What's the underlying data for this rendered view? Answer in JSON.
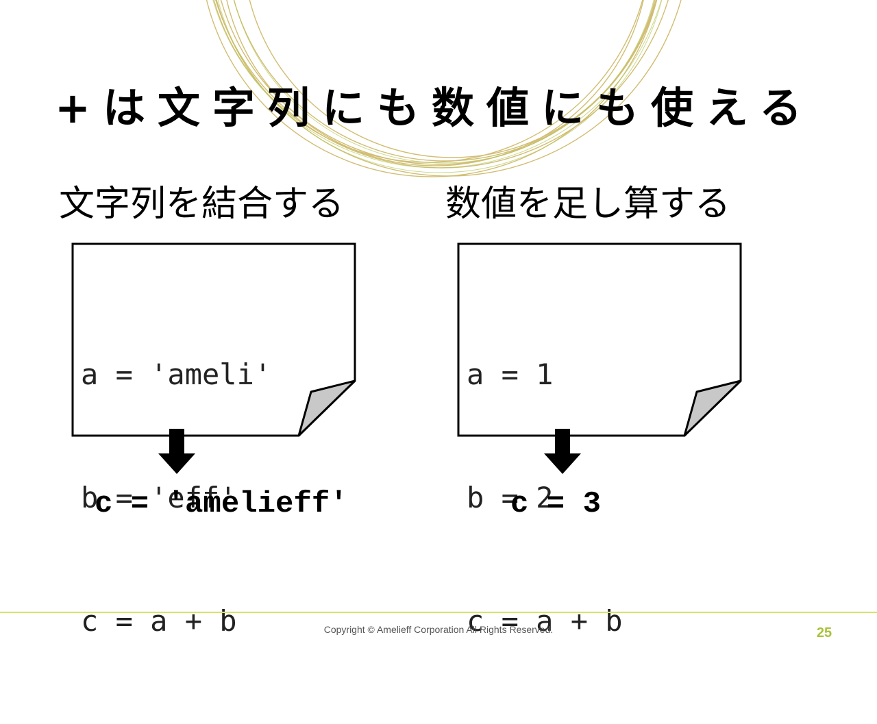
{
  "slide": {
    "title": "+は文字列にも数値にも使える",
    "page_number": "25",
    "copyright": "Copyright © Amelieff Corporation All Rights Reserved."
  },
  "left": {
    "heading": "文字列を結合する",
    "code_lines": [
      "a = 'ameli'",
      "b = 'eff'",
      "c = a + b"
    ],
    "result": "c = 'amelieff'"
  },
  "right": {
    "heading": "数値を足し算する",
    "code_lines": [
      "a = 1",
      "b = 2",
      "c = a + b"
    ],
    "result": "c = 3"
  },
  "colors": {
    "accent_line": "#d6e36a",
    "page_number": "#a9c23a",
    "decoration": "#c9b25a",
    "note_fold": "#c8c8c8"
  },
  "icons": {
    "arrow": "down-arrow-icon",
    "note": "note-icon"
  }
}
